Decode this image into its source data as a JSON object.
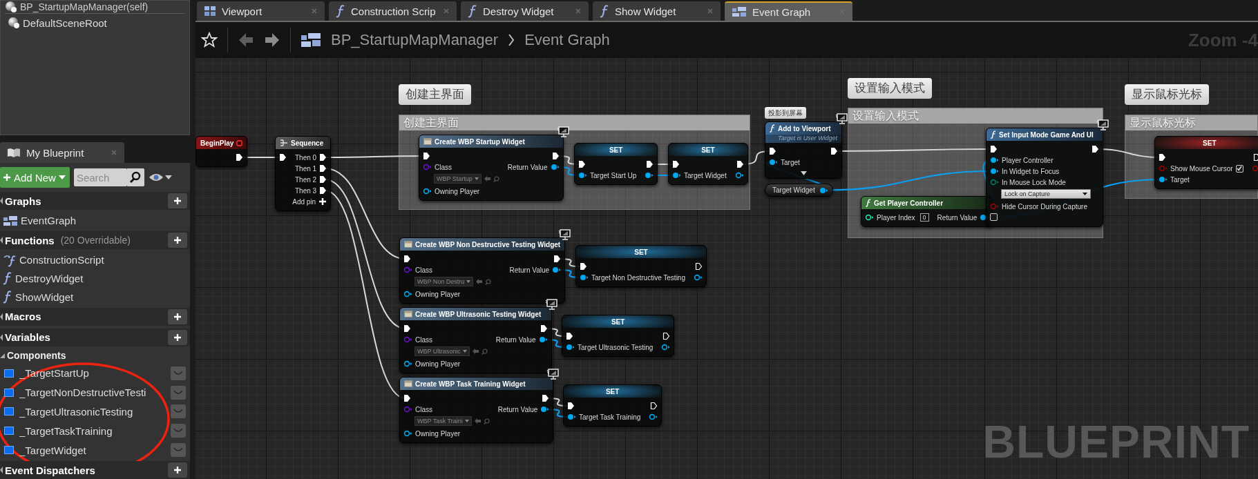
{
  "tabs": [
    {
      "label": "Viewport",
      "kind": "viewport",
      "selected": false
    },
    {
      "label": "Construction Scrip",
      "kind": "function",
      "selected": false
    },
    {
      "label": "Destroy Widget",
      "kind": "function",
      "selected": false
    },
    {
      "label": "Show Widget",
      "kind": "function",
      "selected": false
    },
    {
      "label": "Event Graph",
      "kind": "graph",
      "selected": true
    }
  ],
  "breadcrumb": {
    "blueprint": "BP_StartupMapManager",
    "graph": "Event Graph"
  },
  "components": {
    "root": "BP_StartupMapManager(self)",
    "children": [
      {
        "label": "DefaultSceneRoot"
      }
    ]
  },
  "my_blueprint": {
    "tab": "My Blueprint",
    "add_button": "Add New",
    "search": {
      "placeholder": "Search"
    },
    "sections": [
      {
        "title": "Graphs",
        "items": [
          {
            "label": "EventGraph",
            "kind": "graph"
          }
        ]
      },
      {
        "title": "Functions",
        "note": "(20 Overridable)",
        "items": [
          {
            "label": "ConstructionScript",
            "kind": "construction"
          },
          {
            "label": "DestroyWidget",
            "kind": "function"
          },
          {
            "label": "ShowWidget",
            "kind": "function"
          }
        ]
      },
      {
        "title": "Macros"
      },
      {
        "title": "Variables",
        "categories": [
          {
            "title": "Components",
            "expanded": true,
            "items": [
              {
                "label": "_TargetStartUp"
              },
              {
                "label": "_TargetNonDestructiveTesti"
              },
              {
                "label": "_TargetUltrasonicTesting"
              },
              {
                "label": "_TargetTaskTraining"
              },
              {
                "label": "_TargetWidget"
              }
            ]
          }
        ]
      },
      {
        "title": "Event Dispatchers"
      }
    ]
  },
  "graph": {
    "zoom": "Zoom -4",
    "watermark": "BLUEPRINT",
    "comments": [
      {
        "bubble": "创建主界面",
        "title": "创建主界面"
      },
      {
        "bubble": "设置输入模式",
        "title": "设置输入模式"
      },
      {
        "bubble": "显示鼠标光标",
        "title": "显示鼠标光标"
      }
    ],
    "nodes": [
      {
        "kind": "event",
        "title": "BeginPlay",
        "network_icon": false,
        "rows": [
          {
            "out": {
              "kind": "exec",
              "connected": true
            }
          }
        ]
      },
      {
        "kind": "sequence",
        "title": "Sequence",
        "network_icon": false,
        "rows": [
          {
            "in": {
              "kind": "exec",
              "connected": true
            },
            "out": {
              "label": "Then 0",
              "kind": "exec",
              "connected": true
            }
          },
          {
            "out": {
              "label": "Then 1",
              "kind": "exec",
              "connected": true
            }
          },
          {
            "out": {
              "label": "Then 2",
              "kind": "exec",
              "connected": true
            }
          },
          {
            "out": {
              "label": "Then 3",
              "kind": "exec",
              "connected": true
            }
          },
          {
            "out": {
              "label": "Add pin",
              "kind": "addpin"
            }
          }
        ]
      },
      {
        "kind": "create",
        "title": "Create WBP Startup Widget",
        "network_icon": true,
        "rows": [
          {
            "in": {
              "kind": "exec",
              "connected": true
            },
            "out": {
              "kind": "exec",
              "connected": true
            }
          },
          {
            "in": {
              "label": "Class",
              "kind": "class",
              "connected": false,
              "value": "WBP Startup"
            },
            "out": {
              "label": "Return Value",
              "kind": "object",
              "connected": true
            }
          },
          {
            "in": {
              "label": "Owning Player",
              "kind": "object",
              "connected": false
            }
          }
        ]
      },
      {
        "kind": "set",
        "title": "SET",
        "network_icon": false,
        "rows": [
          {
            "in": {
              "kind": "exec",
              "connected": true
            },
            "out": {
              "kind": "exec",
              "connected": true
            }
          },
          {
            "in": {
              "label": "Target Start Up",
              "kind": "object",
              "connected": true
            },
            "out": {
              "kind": "object",
              "connected": true
            }
          }
        ]
      },
      {
        "kind": "set",
        "title": "SET",
        "network_icon": false,
        "rows": [
          {
            "in": {
              "kind": "exec",
              "connected": true
            },
            "out": {
              "kind": "exec",
              "connected": true
            }
          },
          {
            "in": {
              "label": "Target Widget",
              "kind": "object",
              "connected": true
            },
            "out": {
              "kind": "object",
              "connected": false
            }
          }
        ]
      },
      {
        "kind": "call",
        "title": "Add to Viewport",
        "subtitle": "Target is User Widget",
        "comment": "投影到屏幕",
        "network_icon": true,
        "expandable": true,
        "rows": [
          {
            "in": {
              "kind": "exec",
              "connected": true
            },
            "out": {
              "kind": "exec",
              "connected": true
            }
          },
          {
            "in": {
              "label": "Target",
              "kind": "object",
              "connected": true
            }
          }
        ]
      },
      {
        "kind": "getter",
        "title": "Target Widget",
        "rows": [
          {
            "out": {
              "kind": "object",
              "connected": true
            }
          }
        ]
      },
      {
        "kind": "pure",
        "title": "Get Player Controller",
        "network_icon": false,
        "rows": [
          {
            "in": {
              "label": "Player Index",
              "kind": "int",
              "connected": false,
              "value": "0"
            },
            "out": {
              "label": "Return Value",
              "kind": "object",
              "connected": true
            }
          }
        ]
      },
      {
        "kind": "call",
        "title": "Set Input Mode Game And UI",
        "network_icon": true,
        "rows": [
          {
            "in": {
              "kind": "exec",
              "connected": true
            },
            "out": {
              "kind": "exec",
              "connected": true
            }
          },
          {
            "in": {
              "label": "Player Controller",
              "kind": "object",
              "connected": true
            }
          },
          {
            "in": {
              "label": "In Widget to Focus",
              "kind": "object",
              "connected": true
            }
          },
          {
            "in": {
              "label": "In Mouse Lock Mode",
              "kind": "enum",
              "connected": false,
              "value": "Lock on Capture"
            }
          },
          {
            "in": {
              "label": "Hide Cursor During Capture",
              "kind": "bool",
              "connected": false,
              "checked": false
            }
          }
        ]
      },
      {
        "kind": "set",
        "title": "SET",
        "network_icon": false,
        "rows": [
          {
            "in": {
              "kind": "exec",
              "connected": true
            },
            "out": {
              "kind": "exec",
              "connected": false
            }
          },
          {
            "in": {
              "label": "Show Mouse Cursor",
              "kind": "bool",
              "connected": false,
              "checked": true
            },
            "out": {
              "kind": "bool",
              "connected": false
            }
          },
          {
            "in": {
              "label": "Target",
              "kind": "object",
              "connected": true
            }
          }
        ]
      },
      {
        "kind": "create",
        "title": "Create WBP Non Destructive Testing Widget",
        "network_icon": true,
        "rows": [
          {
            "in": {
              "kind": "exec",
              "connected": true
            },
            "out": {
              "kind": "exec",
              "connected": true
            }
          },
          {
            "in": {
              "label": "Class",
              "kind": "class",
              "connected": false,
              "value": "WBP Non Destru"
            },
            "out": {
              "label": "Return Value",
              "kind": "object",
              "connected": true
            }
          },
          {
            "in": {
              "label": "Owning Player",
              "kind": "object",
              "connected": false
            }
          }
        ]
      },
      {
        "kind": "set",
        "title": "SET",
        "network_icon": false,
        "rows": [
          {
            "in": {
              "kind": "exec",
              "connected": true
            },
            "out": {
              "kind": "exec",
              "connected": false
            }
          },
          {
            "in": {
              "label": "Target Non Destructive Testing",
              "kind": "object",
              "connected": true
            },
            "out": {
              "kind": "object",
              "connected": false
            }
          }
        ]
      },
      {
        "kind": "create",
        "title": "Create WBP Ultrasonic Testing Widget",
        "network_icon": true,
        "rows": [
          {
            "in": {
              "kind": "exec",
              "connected": true
            },
            "out": {
              "kind": "exec",
              "connected": true
            }
          },
          {
            "in": {
              "label": "Class",
              "kind": "class",
              "connected": false,
              "value": "WBP Ultrasonic"
            },
            "out": {
              "label": "Return Value",
              "kind": "object",
              "connected": true
            }
          },
          {
            "in": {
              "label": "Owning Player",
              "kind": "object",
              "connected": false
            }
          }
        ]
      },
      {
        "kind": "set",
        "title": "SET",
        "network_icon": false,
        "rows": [
          {
            "in": {
              "kind": "exec",
              "connected": true
            },
            "out": {
              "kind": "exec",
              "connected": false
            }
          },
          {
            "in": {
              "label": "Target Ultrasonic Testing",
              "kind": "object",
              "connected": true
            },
            "out": {
              "kind": "object",
              "connected": false
            }
          }
        ]
      },
      {
        "kind": "create",
        "title": "Create WBP Task Training Widget",
        "network_icon": true,
        "rows": [
          {
            "in": {
              "kind": "exec",
              "connected": true
            },
            "out": {
              "kind": "exec",
              "connected": true
            }
          },
          {
            "in": {
              "label": "Class",
              "kind": "class",
              "connected": false,
              "value": "WBP Task Traini"
            },
            "out": {
              "label": "Return Value",
              "kind": "object",
              "connected": true
            }
          },
          {
            "in": {
              "label": "Owning Player",
              "kind": "object",
              "connected": false
            }
          }
        ]
      },
      {
        "kind": "set",
        "title": "SET",
        "network_icon": false,
        "rows": [
          {
            "in": {
              "kind": "exec",
              "connected": true
            },
            "out": {
              "kind": "exec",
              "connected": false
            }
          },
          {
            "in": {
              "label": "Target Task Training",
              "kind": "object",
              "connected": true
            },
            "out": {
              "kind": "object",
              "connected": false
            }
          }
        ]
      }
    ]
  }
}
